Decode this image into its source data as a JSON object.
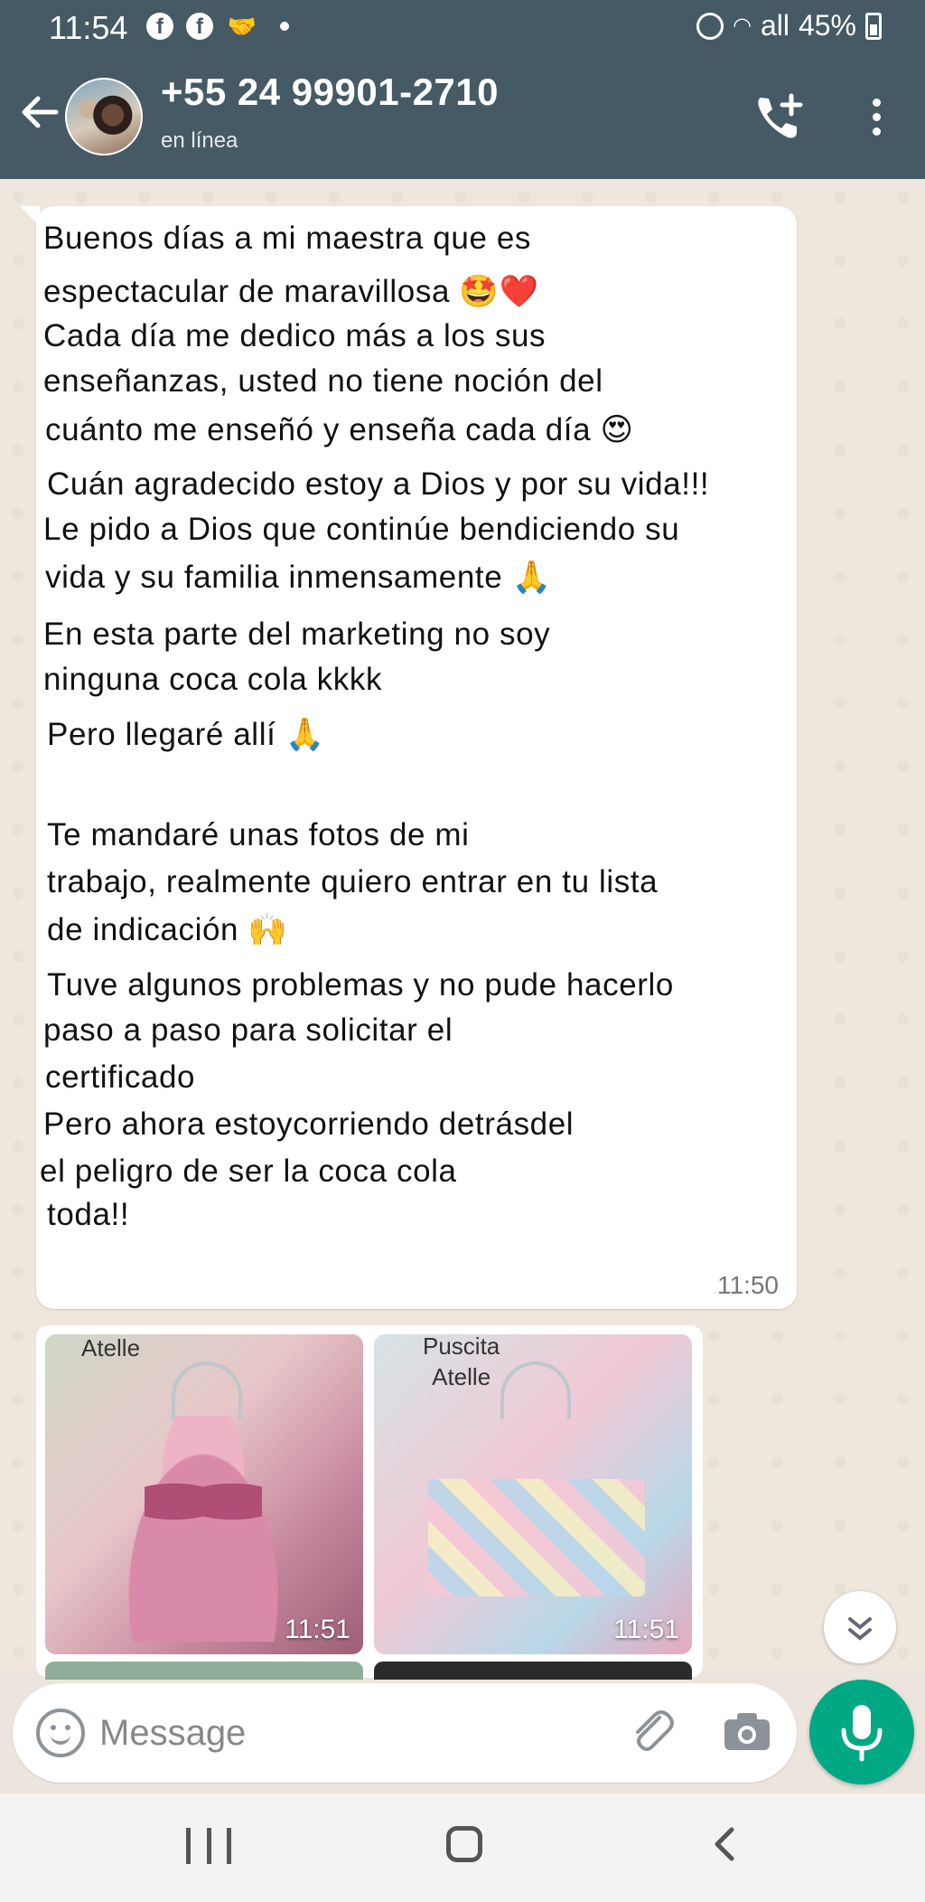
{
  "status_bar": {
    "time": "11:54",
    "signal_text": "all",
    "battery_text": "45%"
  },
  "header": {
    "contact_name": "+55 24 99901-2710",
    "contact_status": "en línea",
    "back_icon": "arrow-left-icon",
    "call_icon": "add-call-icon",
    "menu_icon": "more-vert-icon",
    "bg_color": "#455a64"
  },
  "message": {
    "lines": [
      " Buenos días a mi maestra que es",
      " espectacular de maravillosa 🤩❤️",
      " Cada día me dedico más a los sus",
      " enseñanzas, usted no tiene noción del",
      "cuánto me enseñó y enseña cada día 😍",
      "Cuán agradecido estoy a Dios y por su vida!!!",
      " Le pido a Dios que continúe bendiciendo su",
      "vida y su familia inmensamente 🙏",
      " En esta parte del marketing no          soy",
      "ninguna coca  cola kkkk",
      "Pero llegaré allí       🙏",
      "",
      " Te mandaré unas fotos de mi",
      "trabajo, realmente quiero entrar en tu lista",
      " de indicación 🙌",
      " Tuve algunos problemas y no pude hacerlo",
      "paso a paso para solicitar el",
      " certificado",
      "Pero ahora estoycorriendo detrásdel",
      "el peligro de ser la coca cola",
      " toda!!"
    ],
    "time": "11:50"
  },
  "media": {
    "photos": [
      {
        "label": "Atelle",
        "time": "11:51"
      },
      {
        "label": "Puscita\nAtelle",
        "time": "11:51"
      }
    ]
  },
  "input": {
    "placeholder": "Message"
  },
  "accent_color": "#00a884"
}
